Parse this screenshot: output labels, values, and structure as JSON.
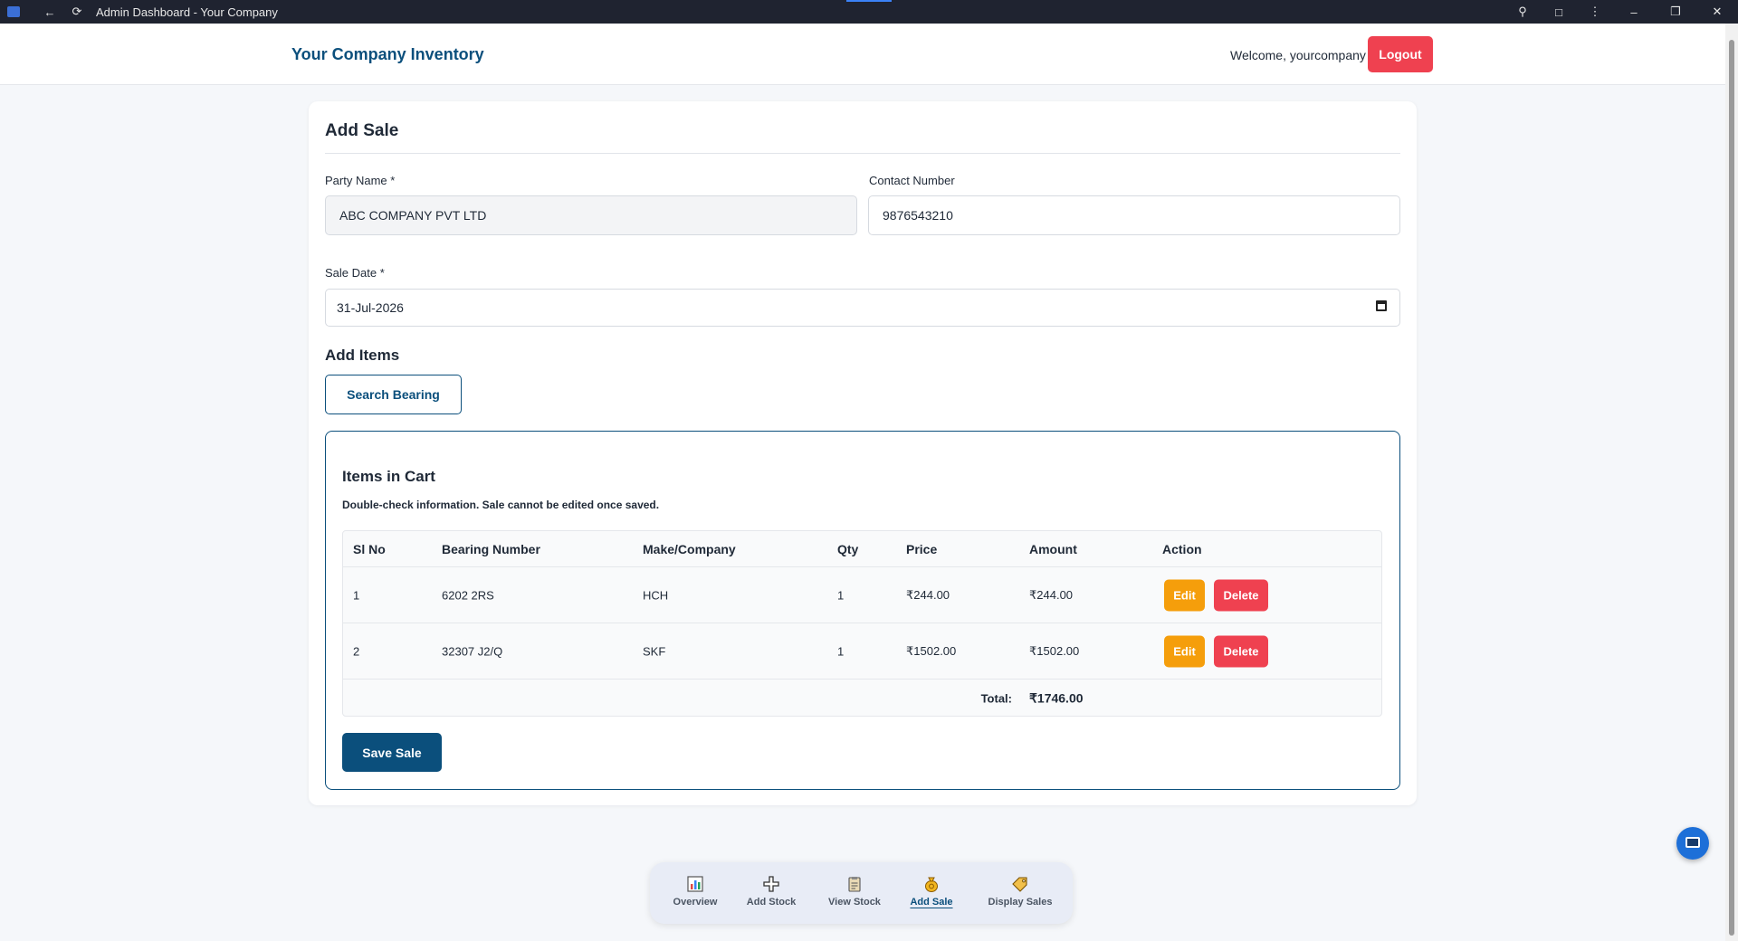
{
  "browser": {
    "window_title": "Admin Dashboard - Your Company"
  },
  "header": {
    "brand": "Your Company Inventory",
    "welcome": "Welcome, yourcompany",
    "logout_label": "Logout"
  },
  "form": {
    "title": "Add Sale",
    "party_name_label": "Party Name *",
    "party_name_value": "ABC COMPANY PVT LTD",
    "contact_label": "Contact Number",
    "contact_value": "9876543210",
    "sale_date_label": "Sale Date *",
    "sale_date_value": "31-Jul-2026",
    "add_items_heading": "Add Items",
    "search_button": "Search Bearing"
  },
  "cart": {
    "title": "Items in Cart",
    "note": "Double-check information. Sale cannot be edited once saved.",
    "columns": [
      "Sl No",
      "Bearing Number",
      "Make/Company",
      "Qty",
      "Price",
      "Amount",
      "Action"
    ],
    "rows": [
      {
        "sl": "1",
        "bearing": "6202 2RS",
        "make": "HCH",
        "qty": "1",
        "price": "₹244.00",
        "amount": "₹244.00"
      },
      {
        "sl": "2",
        "bearing": "32307 J2/Q",
        "make": "SKF",
        "qty": "1",
        "price": "₹1502.00",
        "amount": "₹1502.00"
      }
    ],
    "edit_label": "Edit",
    "delete_label": "Delete",
    "total_label": "Total:",
    "total_value": "₹1746.00",
    "save_button": "Save Sale"
  },
  "nav": {
    "items": [
      {
        "label": "Overview",
        "icon": "chart-icon"
      },
      {
        "label": "Add Stock",
        "icon": "plus-icon"
      },
      {
        "label": "View Stock",
        "icon": "clipboard-icon"
      },
      {
        "label": "Add Sale",
        "icon": "money-bag-icon",
        "active": true
      },
      {
        "label": "Display Sales",
        "icon": "tag-icon"
      }
    ]
  },
  "colors": {
    "brand": "#0b4f7c",
    "danger": "#ef4150",
    "warning": "#f59e0b"
  }
}
